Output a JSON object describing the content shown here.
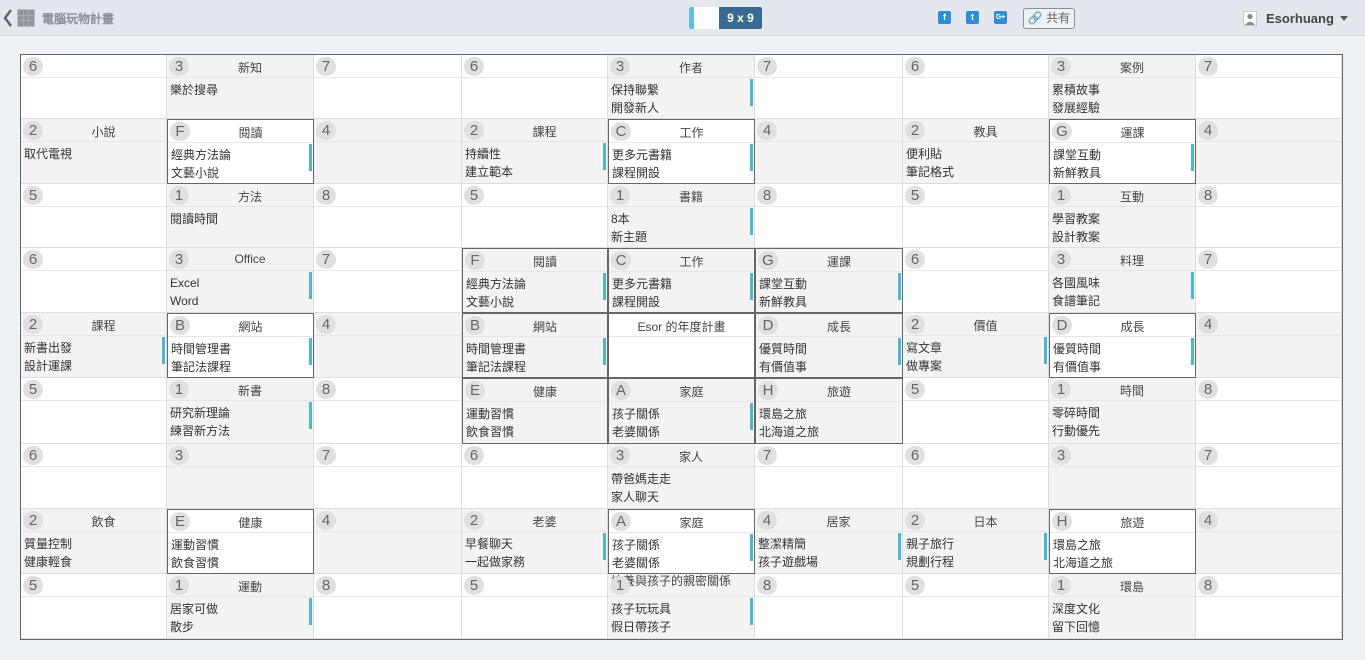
{
  "header": {
    "app_title": "電腦玩物計畫",
    "mode_label": "9 x 9",
    "share_label": "共有",
    "username": "Esorhuang",
    "facebook_icon": "f",
    "twitter_icon": "t",
    "google_icon": "G+"
  },
  "grid": {
    "blocks": [
      [
        {
          "badge": "6",
          "title": "",
          "lines": []
        },
        {
          "badge": "3",
          "title": "新知",
          "lines": [
            "樂於搜尋"
          ]
        },
        {
          "badge": "7",
          "title": "",
          "lines": []
        },
        {
          "badge": "2",
          "title": "小說",
          "lines": [
            "取代電視"
          ]
        },
        {
          "badge": "F",
          "title": "閱讀",
          "lines": [
            "經典方法論",
            "文藝小說"
          ],
          "marker": true
        },
        {
          "badge": "4",
          "title": "",
          "lines": []
        },
        {
          "badge": "5",
          "title": "",
          "lines": []
        },
        {
          "badge": "1",
          "title": "方法",
          "lines": [
            "閱讀時間"
          ]
        },
        {
          "badge": "8",
          "title": "",
          "lines": []
        }
      ],
      [
        {
          "badge": "6",
          "title": "",
          "lines": []
        },
        {
          "badge": "3",
          "title": "作者",
          "lines": [
            "保持聯繫",
            "開發新人"
          ],
          "marker": true
        },
        {
          "badge": "7",
          "title": "",
          "lines": []
        },
        {
          "badge": "2",
          "title": "課程",
          "lines": [
            "持續性",
            "建立範本"
          ],
          "marker": true
        },
        {
          "badge": "C",
          "title": "工作",
          "lines": [
            "更多元書籍",
            "課程開設"
          ],
          "marker": true
        },
        {
          "badge": "4",
          "title": "",
          "lines": []
        },
        {
          "badge": "5",
          "title": "",
          "lines": []
        },
        {
          "badge": "1",
          "title": "書籍",
          "lines": [
            "8本",
            "新主題"
          ],
          "marker": true
        },
        {
          "badge": "8",
          "title": "",
          "lines": []
        }
      ],
      [
        {
          "badge": "6",
          "title": "",
          "lines": []
        },
        {
          "badge": "3",
          "title": "案例",
          "lines": [
            "累積故事",
            "發展經驗"
          ]
        },
        {
          "badge": "7",
          "title": "",
          "lines": []
        },
        {
          "badge": "2",
          "title": "教具",
          "lines": [
            "便利貼",
            "筆記格式"
          ]
        },
        {
          "badge": "G",
          "title": "運課",
          "lines": [
            "課堂互動",
            "新鮮教具"
          ],
          "marker": true
        },
        {
          "badge": "4",
          "title": "",
          "lines": []
        },
        {
          "badge": "5",
          "title": "",
          "lines": []
        },
        {
          "badge": "1",
          "title": "互動",
          "lines": [
            "學習教案",
            "設計教案"
          ]
        },
        {
          "badge": "8",
          "title": "",
          "lines": []
        }
      ],
      [
        {
          "badge": "6",
          "title": "",
          "lines": []
        },
        {
          "badge": "3",
          "title": "Office",
          "lines": [
            "Excel",
            "Word"
          ],
          "marker": true
        },
        {
          "badge": "7",
          "title": "",
          "lines": []
        },
        {
          "badge": "2",
          "title": "課程",
          "lines": [
            "新書出發",
            "設計運課"
          ],
          "marker": true
        },
        {
          "badge": "B",
          "title": "網站",
          "lines": [
            "時間管理書",
            "筆記法課程"
          ],
          "marker": true
        },
        {
          "badge": "4",
          "title": "",
          "lines": []
        },
        {
          "badge": "5",
          "title": "",
          "lines": []
        },
        {
          "badge": "1",
          "title": "新書",
          "lines": [
            "研究新理論",
            "練習新方法"
          ],
          "marker": true
        },
        {
          "badge": "8",
          "title": "",
          "lines": []
        }
      ],
      [
        {
          "badge": "F",
          "title": "閱讀",
          "lines": [
            "經典方法論",
            "文藝小說"
          ],
          "marker": true
        },
        {
          "badge": "C",
          "title": "工作",
          "lines": [
            "更多元書籍",
            "課程開設"
          ],
          "marker": true
        },
        {
          "badge": "G",
          "title": "運課",
          "lines": [
            "課堂互動",
            "新鮮教具"
          ],
          "marker": true
        },
        {
          "badge": "B",
          "title": "網站",
          "lines": [
            "時間管理書",
            "筆記法課程"
          ],
          "marker": true
        },
        {
          "badge": "",
          "title": "Esor 的年度計畫",
          "lines": []
        },
        {
          "badge": "D",
          "title": "成長",
          "lines": [
            "優質時間",
            "有價值事"
          ],
          "marker": true
        },
        {
          "badge": "E",
          "title": "健康",
          "lines": [
            "運動習慣",
            "飲食習慣"
          ]
        },
        {
          "badge": "A",
          "title": "家庭",
          "lines": [
            "孩子關係",
            "老婆關係"
          ],
          "marker": true
        },
        {
          "badge": "H",
          "title": "旅遊",
          "lines": [
            "環島之旅",
            "北海道之旅"
          ]
        }
      ],
      [
        {
          "badge": "6",
          "title": "",
          "lines": []
        },
        {
          "badge": "3",
          "title": "料理",
          "lines": [
            "各國風味",
            "食譜筆記"
          ],
          "marker": true
        },
        {
          "badge": "7",
          "title": "",
          "lines": []
        },
        {
          "badge": "2",
          "title": "價值",
          "lines": [
            "寫文章",
            "做專案"
          ],
          "marker": true
        },
        {
          "badge": "D",
          "title": "成長",
          "lines": [
            "優質時間",
            "有價值事"
          ],
          "marker": true
        },
        {
          "badge": "4",
          "title": "",
          "lines": []
        },
        {
          "badge": "5",
          "title": "",
          "lines": []
        },
        {
          "badge": "1",
          "title": "時間",
          "lines": [
            "零碎時間",
            "行動優先"
          ]
        },
        {
          "badge": "8",
          "title": "",
          "lines": []
        }
      ],
      [
        {
          "badge": "6",
          "title": "",
          "lines": []
        },
        {
          "badge": "3",
          "title": "",
          "lines": []
        },
        {
          "badge": "7",
          "title": "",
          "lines": []
        },
        {
          "badge": "2",
          "title": "飲食",
          "lines": [
            "質量控制",
            "健康輕食"
          ]
        },
        {
          "badge": "E",
          "title": "健康",
          "lines": [
            "運動習慣",
            "飲食習慣"
          ]
        },
        {
          "badge": "4",
          "title": "",
          "lines": []
        },
        {
          "badge": "5",
          "title": "",
          "lines": []
        },
        {
          "badge": "1",
          "title": "運動",
          "lines": [
            "居家可做",
            "散步"
          ],
          "marker": true
        },
        {
          "badge": "8",
          "title": "",
          "lines": []
        }
      ],
      [
        {
          "badge": "6",
          "title": "",
          "lines": []
        },
        {
          "badge": "3",
          "title": "家人",
          "lines": [
            "帶爸媽走走",
            "家人聊天"
          ]
        },
        {
          "badge": "7",
          "title": "",
          "lines": []
        },
        {
          "badge": "2",
          "title": "老婆",
          "lines": [
            "早餐聊天",
            "一起做家務"
          ],
          "marker": true
        },
        {
          "badge": "A",
          "title": "家庭",
          "lines": [
            "孩子關係",
            "老婆關係"
          ],
          "marker": true
        },
        {
          "badge": "4",
          "title": "居家",
          "lines": [
            "整潔精簡",
            "孩子遊戲場"
          ],
          "marker": true
        },
        {
          "badge": "5",
          "title": "",
          "lines": []
        },
        {
          "badge": "1",
          "title": "",
          "lines": [
            "孩子玩玩具",
            "假日帶孩子"
          ],
          "marker": true,
          "overflow": "培養與孩子的親密關係"
        },
        {
          "badge": "8",
          "title": "",
          "lines": []
        }
      ],
      [
        {
          "badge": "6",
          "title": "",
          "lines": []
        },
        {
          "badge": "3",
          "title": "",
          "lines": []
        },
        {
          "badge": "7",
          "title": "",
          "lines": []
        },
        {
          "badge": "2",
          "title": "日本",
          "lines": [
            "親子旅行",
            "規劃行程"
          ],
          "marker": true
        },
        {
          "badge": "H",
          "title": "旅遊",
          "lines": [
            "環島之旅",
            "北海道之旅"
          ]
        },
        {
          "badge": "4",
          "title": "",
          "lines": []
        },
        {
          "badge": "5",
          "title": "",
          "lines": []
        },
        {
          "badge": "1",
          "title": "環島",
          "lines": [
            "深度文化",
            "留下回憶"
          ]
        },
        {
          "badge": "8",
          "title": "",
          "lines": []
        }
      ]
    ]
  }
}
